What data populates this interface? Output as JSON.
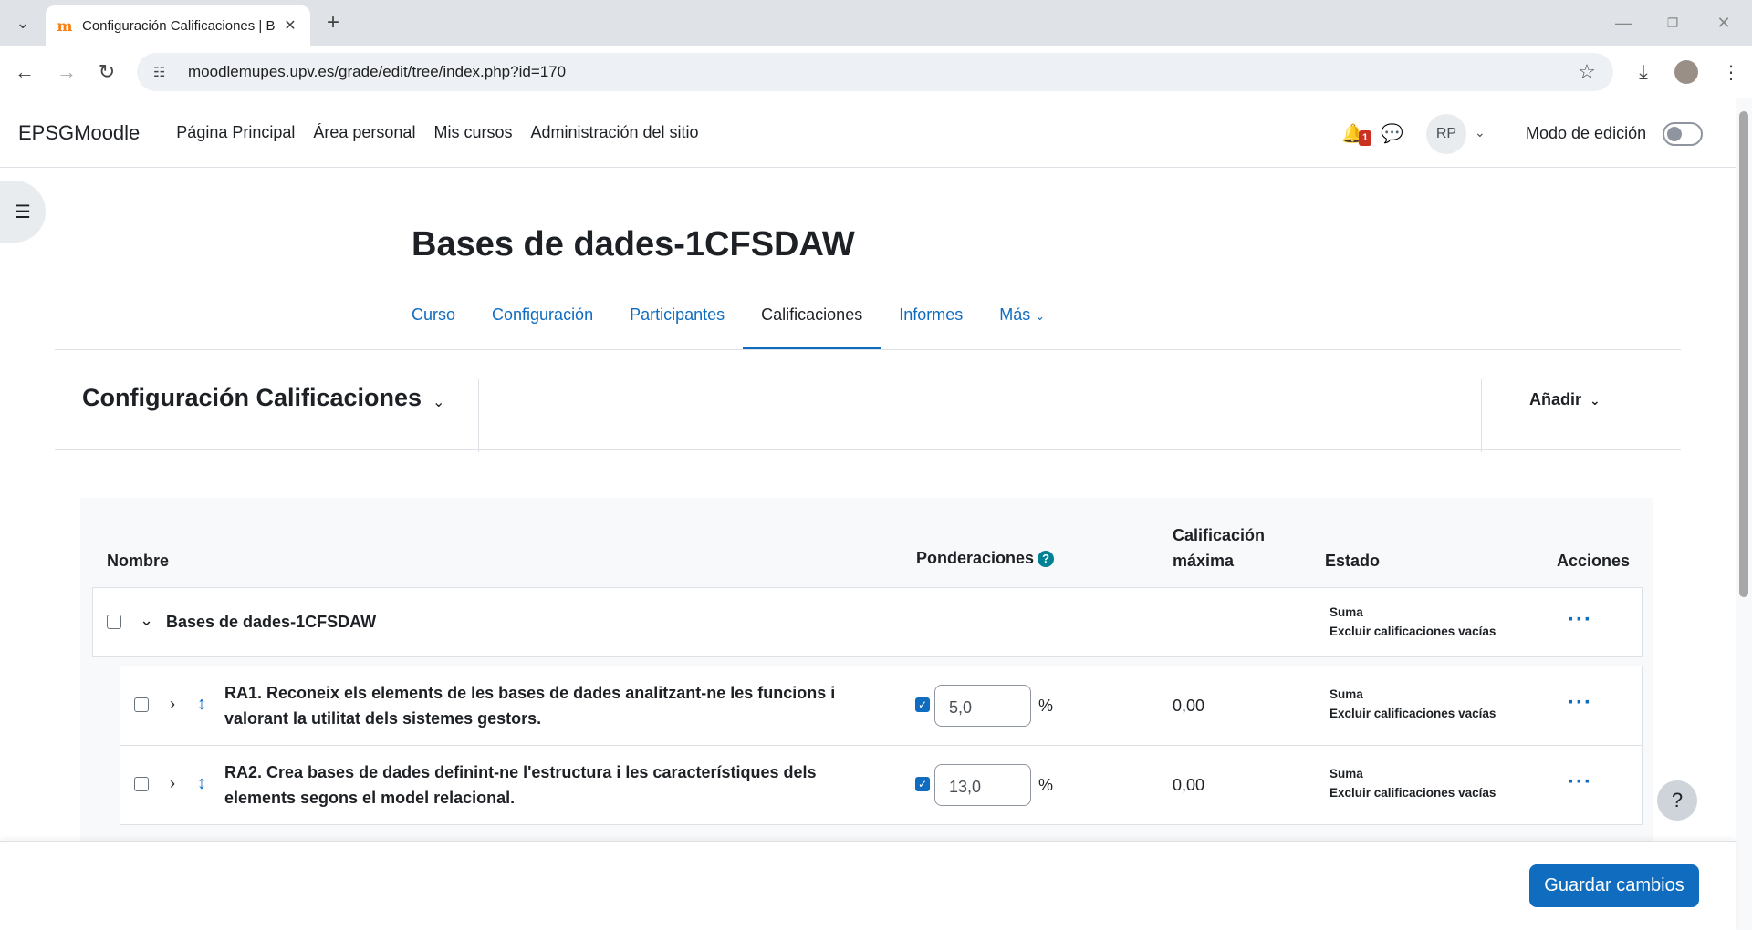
{
  "browser": {
    "tab_title": "Configuración Calificaciones | B",
    "tab_favicon": "m",
    "url": "moodlemupes.upv.es/grade/edit/tree/index.php?id=170"
  },
  "navbar": {
    "brand": "EPSGMoodle",
    "links": [
      "Página Principal",
      "Área personal",
      "Mis cursos",
      "Administración del sitio"
    ],
    "notification_count": "1",
    "avatar_initials": "RP",
    "edit_mode_label": "Modo de edición"
  },
  "course": {
    "title": "Bases de dades-1CFSDAW",
    "tabs": [
      {
        "label": "Curso"
      },
      {
        "label": "Configuración"
      },
      {
        "label": "Participantes"
      },
      {
        "label": "Calificaciones"
      },
      {
        "label": "Informes"
      },
      {
        "label": "Más"
      }
    ]
  },
  "tertiary": {
    "page_selector": "Configuración Calificaciones",
    "add_label": "Añadir"
  },
  "table": {
    "headers": {
      "name": "Nombre",
      "weights": "Ponderaciones",
      "max_grade_line1": "Calificación",
      "max_grade_line2": "máxima",
      "status": "Estado",
      "actions": "Acciones"
    },
    "category": {
      "name": "Bases de dades-1CFSDAW",
      "status_line1": "Suma",
      "status_line2": "Excluir calificaciones vacías"
    },
    "items": [
      {
        "title_line1": "RA1. Reconeix els elements de les bases de dades analitzant-ne les funcions i",
        "title_line2": "valorant la utilitat dels sistemes gestors.",
        "weight": "5,0",
        "pct": "%",
        "max": "0,00",
        "status_line1": "Suma",
        "status_line2": "Excluir calificaciones vacías"
      },
      {
        "title_line1": "RA2. Crea bases de dades definint-ne l'estructura i les característiques dels",
        "title_line2": "elements segons el model relacional.",
        "weight": "13,0",
        "pct": "%",
        "max": "0,00",
        "status_line1": "Suma",
        "status_line2": "Excluir calificaciones vacías"
      }
    ]
  },
  "footer": {
    "save_label": "Guardar cambios"
  },
  "colors": {
    "primary": "#0f6cbf",
    "badge": "#ca3120",
    "help_icon": "#008196"
  }
}
